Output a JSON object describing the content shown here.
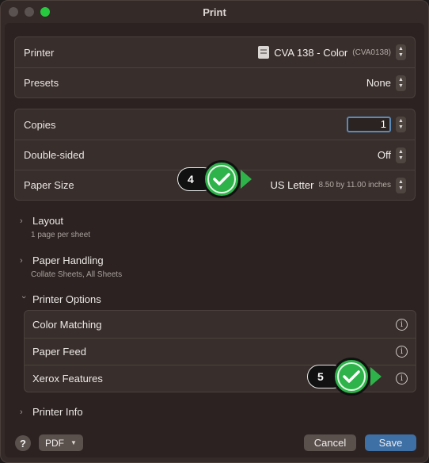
{
  "window": {
    "title": "Print"
  },
  "printer": {
    "label": "Printer",
    "value": "CVA 138 - Color",
    "id": "(CVA0138)"
  },
  "presets": {
    "label": "Presets",
    "value": "None"
  },
  "copies": {
    "label": "Copies",
    "value": "1"
  },
  "double_sided": {
    "label": "Double-sided",
    "value": "Off"
  },
  "paper_size": {
    "label": "Paper Size",
    "value": "US Letter",
    "detail": "8.50 by 11.00 inches"
  },
  "sections": {
    "layout": {
      "title": "Layout",
      "desc": "1 page per sheet"
    },
    "paper_handling": {
      "title": "Paper Handling",
      "desc": "Collate Sheets, All Sheets"
    },
    "printer_options": {
      "title": "Printer Options"
    },
    "printer_info": {
      "title": "Printer Info"
    }
  },
  "printer_options_items": [
    {
      "label": "Color Matching"
    },
    {
      "label": "Paper Feed"
    },
    {
      "label": "Xerox Features"
    }
  ],
  "badges": {
    "b4": "4",
    "b5": "5"
  },
  "footer": {
    "help": "?",
    "pdf": "PDF",
    "cancel": "Cancel",
    "save": "Save"
  },
  "colors": {
    "accent": "#3e6fa5",
    "badge_green": "#2eb34a",
    "focus": "#5b89b8"
  }
}
